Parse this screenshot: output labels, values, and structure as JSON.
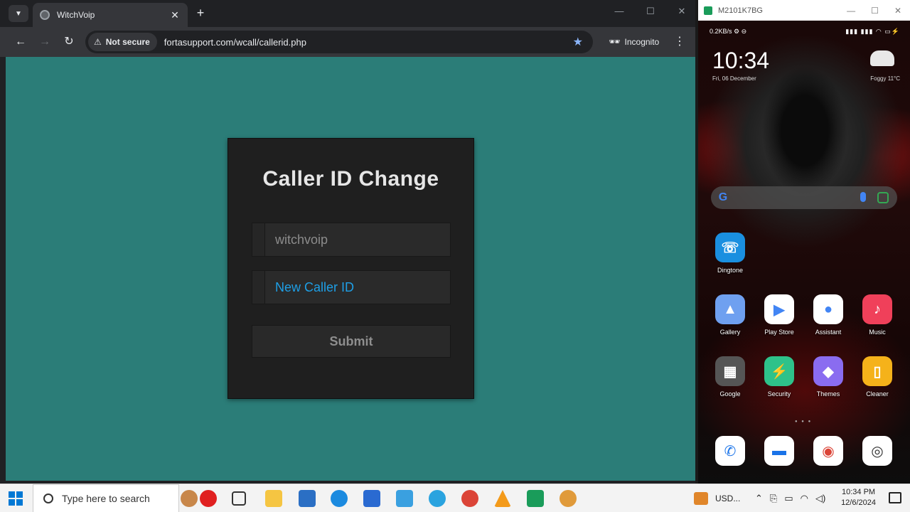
{
  "browser": {
    "tab_title": "WitchVoip",
    "security_label": "Not secure",
    "url": "fortasupport.com/wcall/callerid.php",
    "incognito_label": "Incognito"
  },
  "page": {
    "title": "Caller ID Change",
    "username_placeholder": "witchvoip",
    "callerid_placeholder": "New Caller ID",
    "submit_label": "Submit",
    "background_color": "#2b7d78",
    "accent_color": "#1e9fe6"
  },
  "mirror": {
    "window_title": "M2101K7BG",
    "status_left": "0.2KB/s ⚙ ⊖",
    "status_right": "▮▮▮ ▮▮▮ ◠ ▭⚡",
    "time": "10:34",
    "date": "Fri, 06 December",
    "weather": "Foggy  11°C",
    "apps": [
      {
        "label": "Dingtone",
        "glyph": "☏",
        "color": "#1a8fe0"
      },
      {
        "label": "Gallery",
        "glyph": "▲",
        "color": "#6fa0f0"
      },
      {
        "label": "Play Store",
        "glyph": "▶",
        "color": "#ffffff"
      },
      {
        "label": "Assistant",
        "glyph": "●",
        "color": "#ffffff"
      },
      {
        "label": "Music",
        "glyph": "♪",
        "color": "#f0405a"
      },
      {
        "label": "Google",
        "glyph": "▦",
        "color": "#555555"
      },
      {
        "label": "Security",
        "glyph": "⚡",
        "color": "#2ec28a"
      },
      {
        "label": "Themes",
        "glyph": "◆",
        "color": "#8a6cf0"
      },
      {
        "label": "Cleaner",
        "glyph": "▯",
        "color": "#f5b21a"
      }
    ],
    "dock": [
      {
        "name": "phone",
        "glyph": "✆",
        "color": "#ffffff",
        "fg": "#1a73e8"
      },
      {
        "name": "messages",
        "glyph": "▬",
        "color": "#ffffff",
        "fg": "#1a73e8"
      },
      {
        "name": "chrome",
        "glyph": "◉",
        "color": "#ffffff",
        "fg": "#db4437"
      },
      {
        "name": "camera",
        "glyph": "◎",
        "color": "#ffffff",
        "fg": "#333333"
      }
    ]
  },
  "taskbar": {
    "search_placeholder": "Type here to search",
    "tray_label": "USD...",
    "time": "10:34 PM",
    "date": "12/6/2024"
  }
}
